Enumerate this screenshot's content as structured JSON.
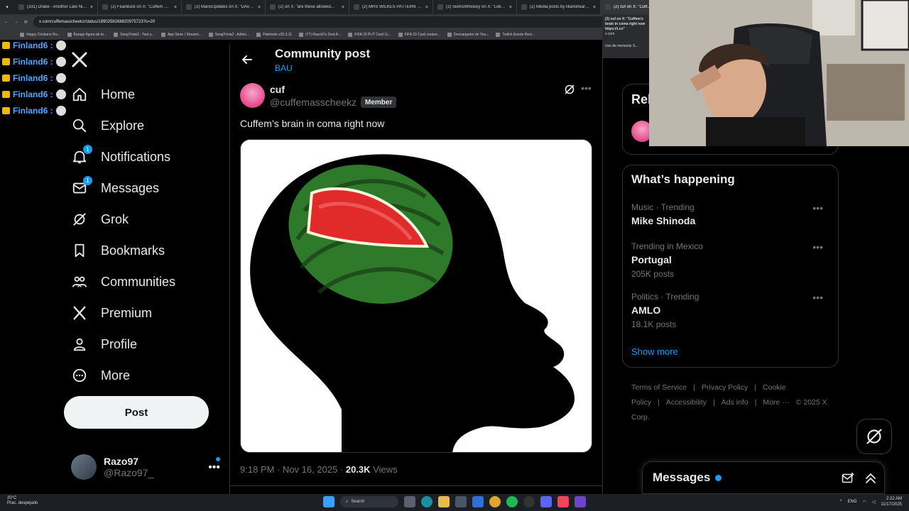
{
  "browser": {
    "tabs": [
      {
        "title": "(331) Drake - Another Late Nig...",
        "active": false
      },
      {
        "title": "(2) FearBuck on X: \"Cuffem wa...",
        "active": false
      },
      {
        "title": "(2) MarioUpdates on X: \"DAvol...",
        "active": false
      },
      {
        "title": "(2) on X: \"are these allowed...",
        "active": false
      },
      {
        "title": "(2) MRS WILKES PATTERN RECI...",
        "active": false
      },
      {
        "title": "(2) SiemsWhiskey on X: \"Literally",
        "active": false
      },
      {
        "title": "(2) Media posts by lilianshearin...",
        "active": false
      },
      {
        "title": "(2) cuf on X: \"Cuff...",
        "active": true
      }
    ],
    "url": "x.com/cuffemasscheekz/status/1990258268820975723?s=20",
    "bookmarks": [
      "Happy Cristiano Ro...",
      "Burago figura de to...",
      "SongTrivia2 - Test y...",
      "App Store / Streami...",
      "SongTrivia2 - Adivin...",
      "Paletools v25.3.11",
      "(77) Razo97s Zest-A...",
      "FIFA 23 PUT Card Cr...",
      "FIFA 23 Card creator...",
      "Descargador de You...",
      "Twitch Emote Resi..."
    ],
    "popup_text": "(2) cuf on X: \"Cuffem's brain in coma right now https://t.co\"",
    "popup_domain": "x.com",
    "popup_memory": "Uso de memoria: 5..."
  },
  "chat": {
    "lines": [
      "Finland6 :",
      "Finland6 :",
      "Finland6 :",
      "Finland6 :",
      "Finland6 :"
    ]
  },
  "nav": {
    "logo": "X",
    "items": [
      {
        "label": "Home",
        "icon": "home-icon",
        "badge": ""
      },
      {
        "label": "Explore",
        "icon": "search-icon",
        "badge": ""
      },
      {
        "label": "Notifications",
        "icon": "bell-icon",
        "badge": "1"
      },
      {
        "label": "Messages",
        "icon": "envelope-icon",
        "badge": "1"
      },
      {
        "label": "Grok",
        "icon": "grok-icon",
        "badge": ""
      },
      {
        "label": "Bookmarks",
        "icon": "bookmark-icon",
        "badge": ""
      },
      {
        "label": "Communities",
        "icon": "people-icon",
        "badge": ""
      },
      {
        "label": "Premium",
        "icon": "x-logo-icon",
        "badge": ""
      },
      {
        "label": "Profile",
        "icon": "person-icon",
        "badge": ""
      },
      {
        "label": "More",
        "icon": "more-circle-icon",
        "badge": ""
      }
    ],
    "post_button": "Post",
    "account": {
      "name": "Razo97",
      "handle": "@Razo97_",
      "more": "•••"
    }
  },
  "main": {
    "header_title": "Community post",
    "header_community": "BAU",
    "post": {
      "author_name": "cuf",
      "author_handle": "@cuffemasscheekz",
      "separator": "·",
      "member_label": "Member",
      "more": "•••",
      "text": "Cuffem’s brain in coma right now",
      "time": "9:18 PM · Nov 16, 2025 · ",
      "views_count": "20.3K",
      "views_label": " Views"
    }
  },
  "right": {
    "relevant_title": "Rel",
    "happening_title": "What’s happening",
    "trends": [
      {
        "context": "Music · Trending",
        "name": "Mike Shinoda",
        "count": ""
      },
      {
        "context": "Trending in Mexico",
        "name": "Portugal",
        "count": "205K posts"
      },
      {
        "context": "Politics · Trending",
        "name": "AMLO",
        "count": "18.1K posts"
      }
    ],
    "show_more": "Show more",
    "footer": [
      "Terms of Service",
      "|",
      "Privacy Policy",
      "|",
      "Cookie Policy",
      "|",
      "Accessibility",
      "|",
      "Ads info",
      "|",
      "More ···",
      "© 2025 X Corp."
    ],
    "messages_title": "Messages"
  },
  "taskbar": {
    "weather_temp": "20°C",
    "weather_desc": "Prac. despejado",
    "search": "Search",
    "lang": "ENG",
    "time": "2:22 AM",
    "date": "11/17/2025"
  },
  "colors": {
    "accent": "#1d9bf0",
    "background": "#000000",
    "border": "#2f3336",
    "text": "#e7e9ea",
    "muted": "#71767b"
  }
}
